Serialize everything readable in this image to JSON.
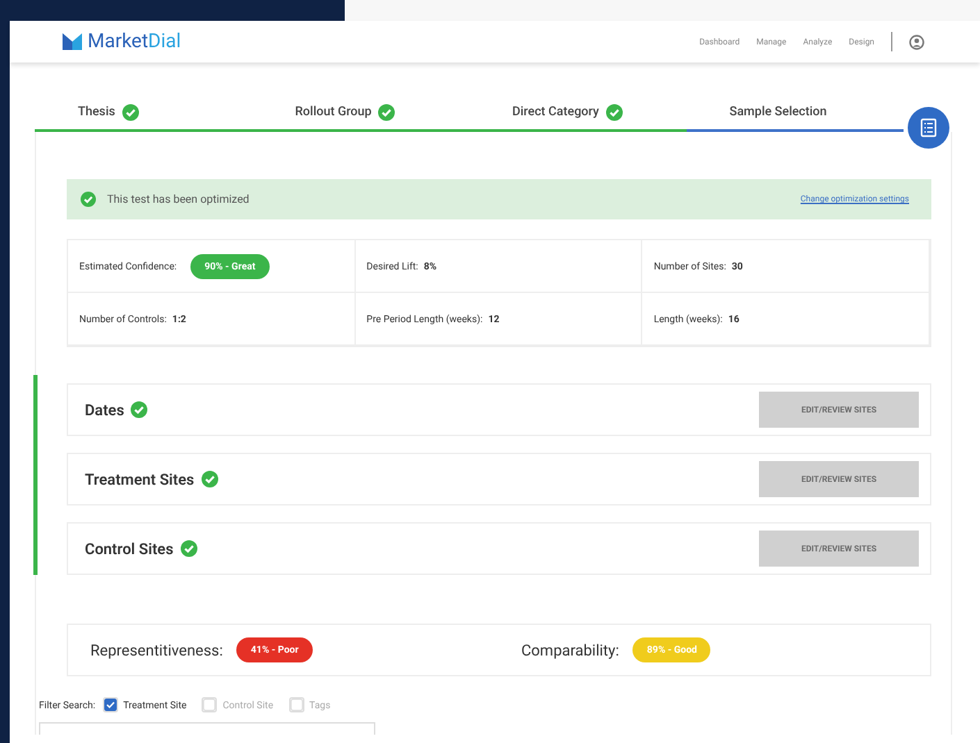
{
  "header": {
    "logo": {
      "part1": "Market",
      "part2": "Dial"
    },
    "nav": [
      "Dashboard",
      "Manage",
      "Analyze",
      "Design"
    ]
  },
  "steps": [
    {
      "label": "Thesis",
      "completed": true,
      "selected": false
    },
    {
      "label": "Rollout Group",
      "completed": true,
      "selected": false
    },
    {
      "label": "Direct Category",
      "completed": true,
      "selected": false
    },
    {
      "label": "Sample Selection",
      "completed": false,
      "selected": true
    }
  ],
  "banner": {
    "message": "This test has been optimized",
    "link": "Change optimization settings"
  },
  "summary": [
    {
      "label": "Estimated Confidence:",
      "badge": "90% - Great",
      "color": "#3bb54a"
    },
    {
      "label": "Desired Lift:",
      "value": "8%"
    },
    {
      "label": "Number of Sites:",
      "value": "30"
    },
    {
      "label": "Number of Controls:",
      "value": "1:2"
    },
    {
      "label": "Pre Period Length (weeks):",
      "value": "12"
    },
    {
      "label": "Length (weeks):",
      "value": "16"
    }
  ],
  "sections": [
    {
      "title": "Dates",
      "completed": true,
      "button": "EDIT/REVIEW SITES",
      "disabled": true
    },
    {
      "title": "Treatment Sites",
      "completed": true,
      "button": "EDIT/REVIEW SITES",
      "disabled": true
    },
    {
      "title": "Control Sites",
      "completed": true,
      "button": "EDIT/REVIEW SITES",
      "disabled": true
    }
  ],
  "scores": [
    {
      "label": "Representitiveness:",
      "badge": "41% - Poor",
      "color": "#e53126"
    },
    {
      "label": "Comparability:",
      "badge": "89% - Good",
      "color": "#f0cc1c"
    }
  ],
  "filter": {
    "label": "Filter Search:",
    "options": [
      {
        "label": "Treatment Site",
        "checked": true
      },
      {
        "label": "Control Site",
        "checked": false
      },
      {
        "label": "Tags",
        "checked": false
      }
    ]
  }
}
